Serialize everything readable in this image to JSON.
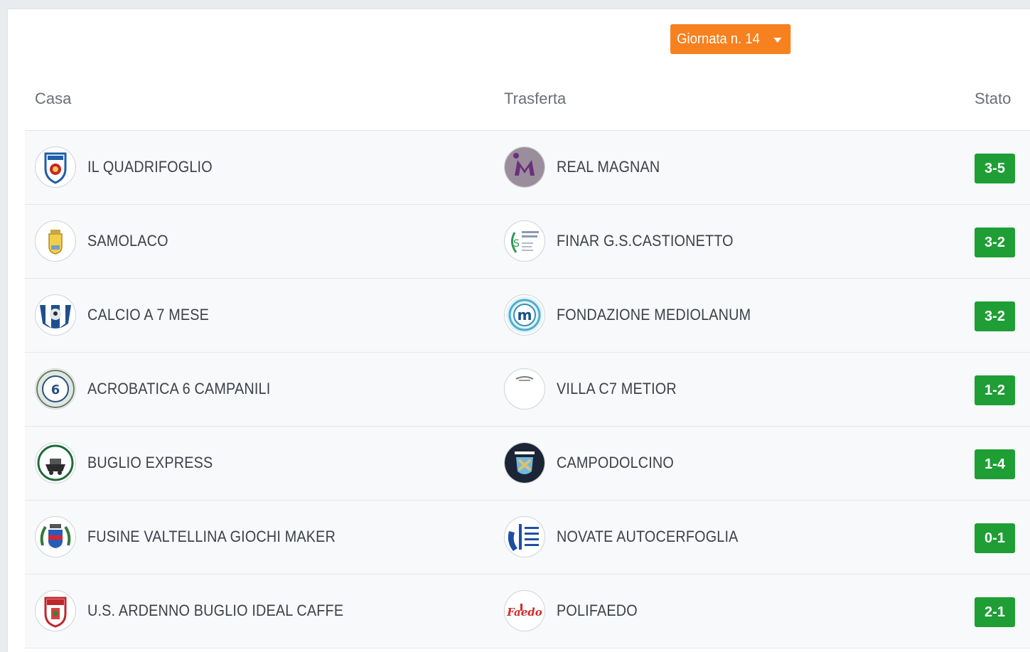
{
  "round_selector": {
    "label": "Giornata n. 14",
    "icon": "caret-down-icon"
  },
  "table": {
    "headers": {
      "home": "Casa",
      "away": "Trasferta",
      "status": "Stato"
    },
    "rows": [
      {
        "home": "IL QUADRIFOGLIO",
        "away": "REAL MAGNAN",
        "score": "3-5"
      },
      {
        "home": "SAMOLACO",
        "away": "FINAR G.S.CASTIONETTO",
        "score": "3-2"
      },
      {
        "home": "CALCIO A 7 MESE",
        "away": "FONDAZIONE MEDIOLANUM",
        "score": "3-2"
      },
      {
        "home": "ACROBATICA 6 CAMPANILI",
        "away": "VILLA C7 METIOR",
        "score": "1-2"
      },
      {
        "home": "BUGLIO EXPRESS",
        "away": "CAMPODOLCINO",
        "score": "1-4"
      },
      {
        "home": "FUSINE VALTELLINA GIOCHI MAKER",
        "away": "NOVATE AUTOCERFOGLIA",
        "score": "0-1"
      },
      {
        "home": "U.S. ARDENNO BUGLIO IDEAL CAFFE",
        "away": "POLIFAEDO",
        "score": "2-1"
      }
    ]
  },
  "colors": {
    "accent": "#f7811f",
    "score_badge": "#1e9e34"
  }
}
